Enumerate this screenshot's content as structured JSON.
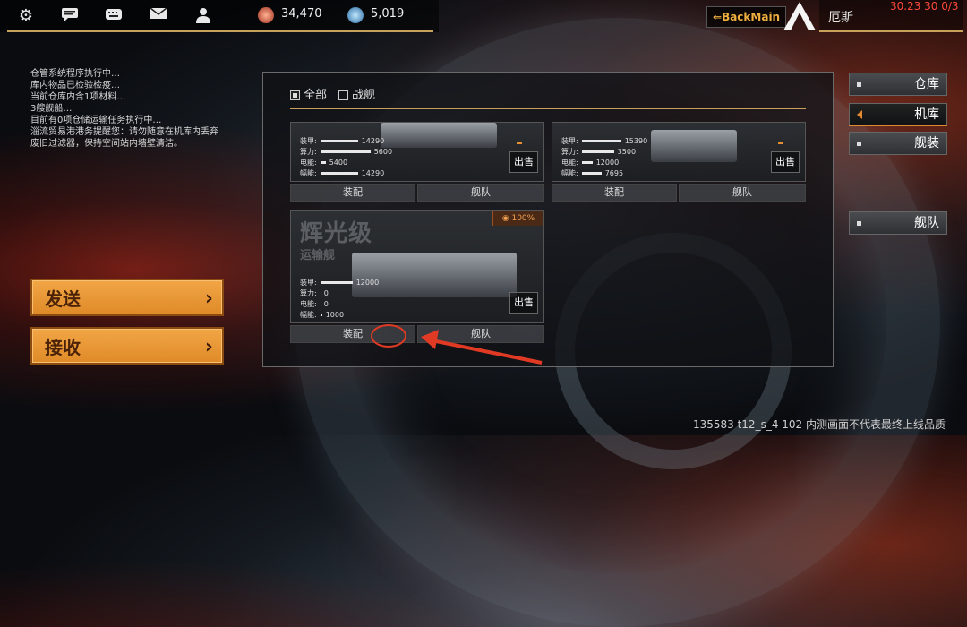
{
  "topbar": {
    "icons": [
      "gear-icon",
      "chat-icon",
      "keyboard-icon",
      "mail-icon",
      "user-icon"
    ],
    "credits": "34,470",
    "crystals": "5,019",
    "back_label": "BackMain",
    "player_name": "厄斯",
    "debug": "30.23 30 0/3"
  },
  "log": [
    "仓管系统程序执行中…",
    "库内物品已检验检疫…",
    "当前仓库内含1项材料…",
    "3艘舰船…",
    "目前有0项仓储运输任务执行中…",
    "淄流贸易港港务提醒您：请勿随意在机库内丢弃",
    "废旧过滤器，保持空间站内墙壁清洁。"
  ],
  "actions": {
    "send": "发送",
    "receive": "接收"
  },
  "filters": {
    "all": "全部",
    "warship": "战舰"
  },
  "stat_labels": {
    "armor": "装甲:",
    "power": "算力:",
    "energy": "电能:",
    "cargo": "幅能:"
  },
  "ships": [
    {
      "armor": "14290",
      "power": "5600",
      "energy": "5400",
      "cargo": "14290"
    },
    {
      "armor": "15390",
      "power": "3500",
      "energy": "12000",
      "cargo": "7695"
    },
    {
      "name": "辉光级",
      "class": "运输舰",
      "percent": "100%",
      "armor": "12000",
      "power": "0",
      "energy": "0",
      "cargo": "1000"
    }
  ],
  "card_buttons": {
    "sell": "出售",
    "equip": "装配",
    "fleet": "舰队"
  },
  "side_menu": [
    "仓库",
    "机库",
    "舰装",
    "舰队"
  ],
  "footer": "135583 t12_s_4 102  内测画面不代表最终上线品质",
  "colors": {
    "accent": "#e89030",
    "gold": "#c8a25a",
    "highlight": "#e03a24"
  }
}
